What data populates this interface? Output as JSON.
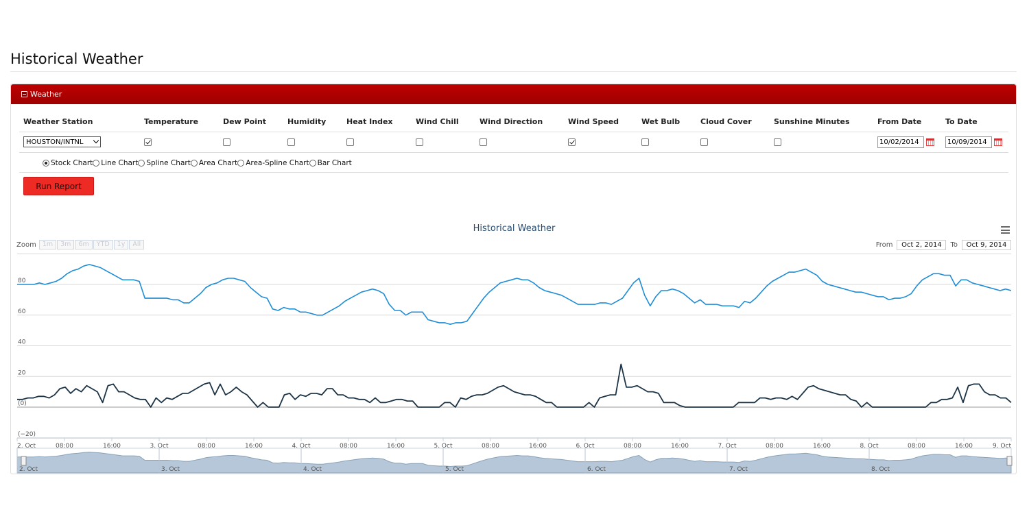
{
  "page": {
    "title": "Historical Weather"
  },
  "panel": {
    "header_label": "Weather",
    "columns": [
      "Weather Station",
      "Temperature",
      "Dew Point",
      "Humidity",
      "Heat Index",
      "Wind Chill",
      "Wind Direction",
      "Wind Speed",
      "Wet Bulb",
      "Cloud Cover",
      "Sunshine Minutes",
      "From Date",
      "To Date"
    ],
    "station": "HOUSTON/INTNL",
    "checks": {
      "temperature": true,
      "dew_point": false,
      "humidity": false,
      "heat_index": false,
      "wind_chill": false,
      "wind_direction": false,
      "wind_speed": true,
      "wet_bulb": false,
      "cloud_cover": false,
      "sunshine_minutes": false
    },
    "from_date": "10/02/2014",
    "to_date": "10/09/2014",
    "chart_types": [
      "Stock Chart",
      "Line Chart",
      "Spline Chart",
      "Area Chart",
      "Area-Spline Chart",
      "Bar Chart"
    ],
    "selected_chart_type": "Stock Chart",
    "run_label": "Run Report"
  },
  "chart_controls": {
    "zoom_label": "Zoom",
    "zoom_buttons": [
      "1m",
      "3m",
      "6m",
      "YTD",
      "1y",
      "All"
    ],
    "from_label": "From",
    "from_value": "Oct 2, 2014",
    "to_label": "To",
    "to_value": "Oct 9, 2014"
  },
  "chart_data": {
    "type": "line",
    "title": "Historical Weather",
    "colors": {
      "temperature": "#1f8dd6",
      "wind_speed": "#1c3345",
      "navigator_fill": "#b5c7d8",
      "navigator_line": "#8aa2b8"
    },
    "ylim": [
      -20,
      100
    ],
    "yticks": [
      80,
      60,
      40,
      20
    ],
    "ytick_labels": [
      "80",
      "60",
      "40",
      "20",
      "(0)",
      "(−20)"
    ],
    "xtick_labels": [
      "2. Oct",
      "08:00",
      "16:00",
      "3. Oct",
      "08:00",
      "16:00",
      "4. Oct",
      "08:00",
      "16:00",
      "5. Oct",
      "08:00",
      "16:00",
      "6. Oct",
      "08:00",
      "16:00",
      "7. Oct",
      "08:00",
      "16:00",
      "8. Oct",
      "08:00",
      "16:00",
      "9. Oct"
    ],
    "xtick_hours": [
      0,
      8,
      16,
      24,
      32,
      40,
      48,
      56,
      64,
      72,
      80,
      88,
      96,
      104,
      112,
      120,
      128,
      136,
      144,
      152,
      160,
      168
    ],
    "x_start_label": "2. Oct",
    "hours_per_point": 1,
    "navigator_labels": [
      "2. Oct",
      "3. Oct",
      "4. Oct",
      "5. Oct",
      "6. Oct",
      "7. Oct",
      "8. Oct"
    ],
    "grid": true,
    "legend": "none",
    "series": [
      {
        "name": "Temperature",
        "values": [
          80,
          80,
          80,
          80,
          81,
          80,
          81,
          82,
          84,
          87,
          89,
          90,
          92,
          93,
          92,
          91,
          89,
          87,
          85,
          83,
          83,
          83,
          82,
          71,
          71,
          71,
          71,
          71,
          70,
          70,
          68,
          68,
          71,
          74,
          78,
          80,
          81,
          83,
          84,
          84,
          83,
          82,
          78,
          75,
          72,
          71,
          64,
          63,
          65,
          64,
          64,
          62,
          62,
          61,
          60,
          60,
          62,
          64,
          66,
          69,
          71,
          73,
          75,
          76,
          77,
          76,
          74,
          67,
          63,
          63,
          60,
          62,
          62,
          62,
          57,
          56,
          55,
          55,
          54,
          55,
          55,
          56,
          61,
          66,
          71,
          75,
          78,
          81,
          82,
          83,
          84,
          83,
          83,
          81,
          78,
          76,
          75,
          74,
          73,
          71,
          69,
          67,
          67,
          67,
          67,
          68,
          68,
          67,
          69,
          71,
          76,
          81,
          84,
          73,
          66,
          72,
          76,
          76,
          77,
          76,
          74,
          71,
          68,
          70,
          67,
          67,
          67,
          66,
          66,
          66,
          65,
          69,
          68,
          71,
          75,
          79,
          82,
          84,
          86,
          88,
          88,
          89,
          90,
          88,
          86,
          82,
          80,
          79,
          78,
          77,
          76,
          75,
          75,
          74,
          73,
          72,
          72,
          70,
          71,
          71,
          72,
          74,
          79,
          83,
          85,
          87,
          87,
          86,
          86,
          79,
          83,
          83,
          81,
          80,
          79,
          78,
          77,
          76,
          77,
          76
        ]
      },
      {
        "name": "Wind Speed",
        "values": [
          5,
          5,
          6,
          6,
          7,
          7,
          6,
          8,
          12,
          13,
          9,
          12,
          10,
          14,
          12,
          10,
          3,
          14,
          15,
          10,
          10,
          8,
          6,
          5,
          5,
          0,
          6,
          3,
          6,
          5,
          7,
          9,
          9,
          11,
          13,
          15,
          16,
          8,
          15,
          8,
          10,
          13,
          10,
          8,
          4,
          0,
          3,
          0,
          0,
          0,
          8,
          9,
          5,
          8,
          7,
          9,
          9,
          8,
          12,
          12,
          8,
          8,
          6,
          6,
          5,
          5,
          3,
          6,
          3,
          3,
          4,
          5,
          5,
          4,
          4,
          0,
          0,
          0,
          0,
          0,
          3,
          3,
          0,
          6,
          5,
          7,
          8,
          8,
          9,
          11,
          13,
          14,
          12,
          10,
          9,
          8,
          8,
          7,
          5,
          3,
          3,
          0,
          0,
          0,
          0,
          0,
          0,
          3,
          0,
          6,
          7,
          8,
          8,
          28,
          13,
          13,
          14,
          12,
          10,
          10,
          9,
          3,
          3,
          3,
          1,
          0,
          0,
          0,
          0,
          0,
          0,
          0,
          0,
          0,
          0,
          3,
          3,
          3,
          3,
          6,
          6,
          5,
          6,
          6,
          5,
          7,
          5,
          9,
          13,
          14,
          12,
          11,
          10,
          9,
          8,
          8,
          5,
          4,
          0,
          3,
          0,
          0,
          0,
          0,
          0,
          0,
          0,
          0,
          0,
          0,
          0,
          3,
          3,
          5,
          5,
          6,
          13,
          3,
          14,
          15,
          15,
          10,
          8,
          8,
          6,
          6,
          3
        ]
      }
    ]
  }
}
